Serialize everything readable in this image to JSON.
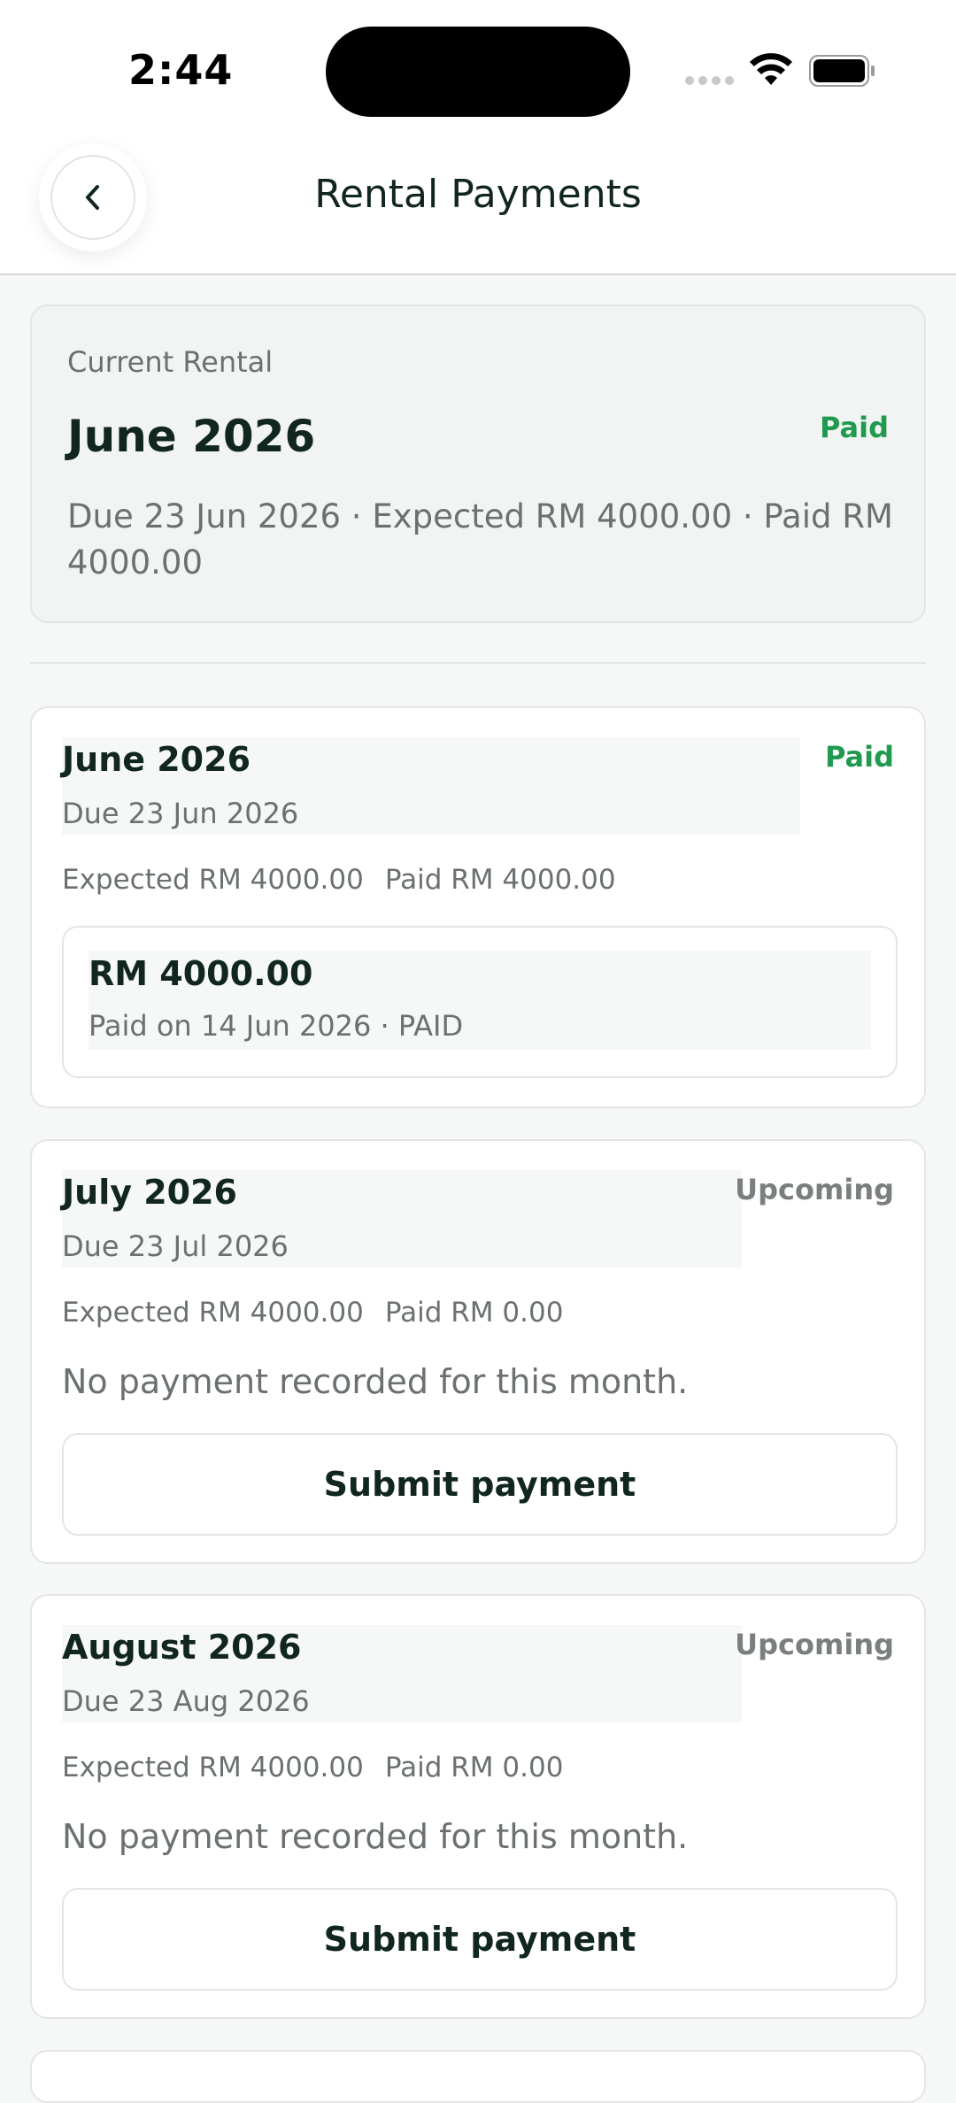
{
  "status_bar": {
    "time": "2:44"
  },
  "header": {
    "title": "Rental Payments"
  },
  "current": {
    "label": "Current Rental",
    "month": "June 2026",
    "status": "Paid",
    "description": "Due 23 Jun 2026 · Expected RM 4000.00 · Paid RM 4000.00"
  },
  "months": [
    {
      "title": "June 2026",
      "due": "Due 23 Jun 2026",
      "status": "Paid",
      "expected": "Expected RM 4000.00",
      "paid": "Paid RM 4000.00",
      "payment": {
        "amount": "RM 4000.00",
        "meta": "Paid on 14 Jun 2026 · PAID"
      }
    },
    {
      "title": "July 2026",
      "due": "Due 23 Jul 2026",
      "status": "Upcoming",
      "expected": "Expected RM 4000.00",
      "paid": "Paid RM 0.00",
      "empty_text": "No payment recorded for this month.",
      "button_label": "Submit payment"
    },
    {
      "title": "August 2026",
      "due": "Due 23 Aug 2026",
      "status": "Upcoming",
      "expected": "Expected RM 4000.00",
      "paid": "Paid RM 0.00",
      "empty_text": "No payment recorded for this month.",
      "button_label": "Submit payment"
    }
  ],
  "colors": {
    "primary_text": "#10261f",
    "muted_text": "#6b716f",
    "paid": "#1f9a4e",
    "upcoming": "#7a7f7d"
  },
  "icons": {
    "back": "chevron-left-icon",
    "wifi": "wifi-icon",
    "battery": "battery-icon",
    "signal": "cellular-signal-icon"
  }
}
